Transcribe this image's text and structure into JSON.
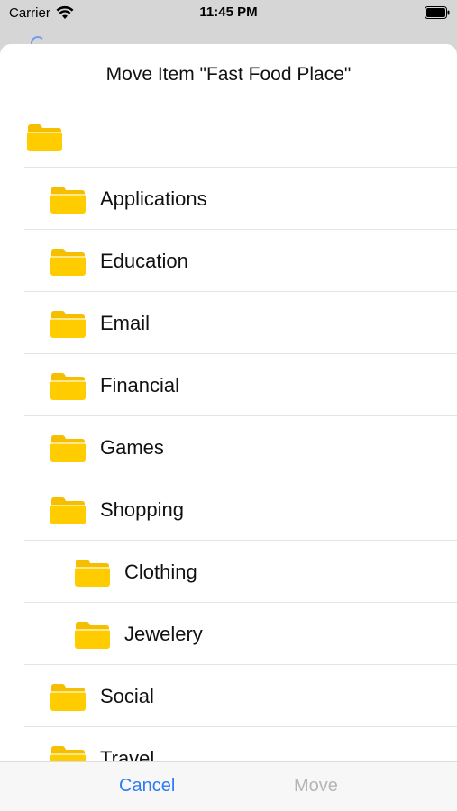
{
  "status_bar": {
    "carrier": "Carrier",
    "time": "11:45 PM"
  },
  "sheet": {
    "title": "Move Item \"Fast Food Place\""
  },
  "folders": [
    {
      "label": "",
      "indent": 0
    },
    {
      "label": "Applications",
      "indent": 1
    },
    {
      "label": "Education",
      "indent": 1
    },
    {
      "label": "Email",
      "indent": 1
    },
    {
      "label": "Financial",
      "indent": 1
    },
    {
      "label": "Games",
      "indent": 1
    },
    {
      "label": "Shopping",
      "indent": 1
    },
    {
      "label": "Clothing",
      "indent": 2
    },
    {
      "label": "Jewelery",
      "indent": 2
    },
    {
      "label": "Social",
      "indent": 1
    },
    {
      "label": "Travel",
      "indent": 1
    }
  ],
  "toolbar": {
    "cancel_label": "Cancel",
    "move_label": "Move"
  },
  "colors": {
    "accent": "#2f7bf5",
    "folder": "#ffcc00",
    "disabled": "#b5b5b5"
  },
  "icons": {
    "folder": "folder-icon",
    "wifi": "wifi-icon",
    "battery": "battery-icon"
  }
}
